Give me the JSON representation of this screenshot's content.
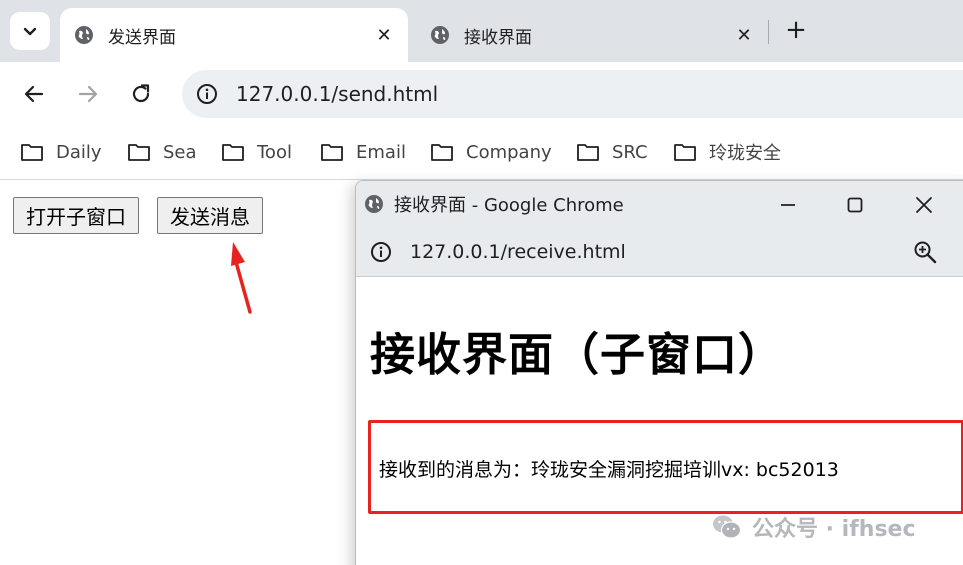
{
  "browser": {
    "tabs": [
      {
        "title": "发送界面",
        "active": true
      },
      {
        "title": "接收界面",
        "active": false
      }
    ],
    "new_tab_glyph": "+",
    "close_glyph": "✕",
    "address": "127.0.0.1/send.html",
    "bookmarks": [
      "Daily",
      "Sea",
      "Tool",
      "Email",
      "Company",
      "SRC",
      "玲珑安全"
    ]
  },
  "page": {
    "buttons": {
      "open_child": "打开子窗口",
      "send_message": "发送消息"
    }
  },
  "popup": {
    "window_title": "接收界面 - Google Chrome",
    "address": "127.0.0.1/receive.html",
    "heading": "接收界面（子窗口）",
    "message": "接收到的消息为：玲珑安全漏洞挖掘培训vx: bc52013"
  },
  "watermark": "公众号 · ifhsec",
  "colors": {
    "highlight_red": "#e8231f",
    "annotation_arrow": "#e8231f",
    "tabstrip": "#dfe3e7",
    "omnibox": "#edf0f3"
  },
  "icons": [
    "chevron-down-icon",
    "globe-icon",
    "close-icon",
    "plus-icon",
    "back-arrow-icon",
    "forward-arrow-icon",
    "reload-icon",
    "info-icon",
    "folder-icon",
    "minimize-icon",
    "maximize-icon",
    "zoom-in-icon",
    "wechat-icon"
  ]
}
